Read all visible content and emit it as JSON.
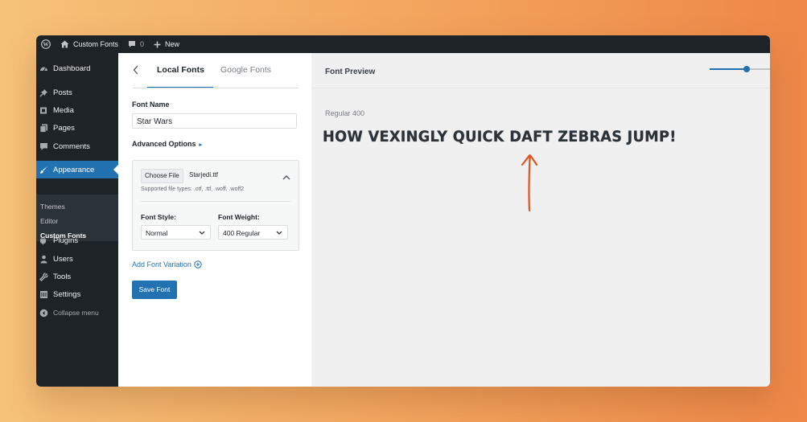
{
  "adminbar": {
    "site_name": "Custom Fonts",
    "comments_count": "0",
    "new_label": "New"
  },
  "sidebar": {
    "items": [
      {
        "label": "Dashboard",
        "icon": "dashboard-icon"
      },
      {
        "label": "Posts",
        "icon": "pin-icon"
      },
      {
        "label": "Media",
        "icon": "media-icon"
      },
      {
        "label": "Pages",
        "icon": "pages-icon"
      },
      {
        "label": "Comments",
        "icon": "comment-icon"
      },
      {
        "label": "Appearance",
        "icon": "brush-icon"
      },
      {
        "label": "Plugins",
        "icon": "plugin-icon"
      },
      {
        "label": "Users",
        "icon": "user-icon"
      },
      {
        "label": "Tools",
        "icon": "wrench-icon"
      },
      {
        "label": "Settings",
        "icon": "settings-icon"
      },
      {
        "label": "Collapse menu",
        "icon": "collapse-icon"
      }
    ],
    "submenu": [
      "Themes",
      "Editor",
      "Custom Fonts"
    ]
  },
  "panel": {
    "tabs": [
      "Local Fonts",
      "Google Fonts"
    ],
    "font_name_label": "Font Name",
    "font_name_value": "Star Wars",
    "advanced_label": "Advanced Options",
    "choose_file_label": "Choose File",
    "file_name": "Starjedi.ttf",
    "supported_types": "Supported file types: .otf, .ttf, .woff, .woff2",
    "font_style_label": "Font Style:",
    "font_style_value": "Normal",
    "font_weight_label": "Font Weight:",
    "font_weight_value": "400 Regular",
    "add_variation_label": "Add Font Variation",
    "save_label": "Save Font"
  },
  "preview": {
    "title": "Font Preview",
    "weight_label": "Regular 400",
    "sample_text": "How vexingly quick daft zebras jump!",
    "size_level": 0.62,
    "accent": "#2271b1",
    "arrow_color": "#e0531f"
  }
}
